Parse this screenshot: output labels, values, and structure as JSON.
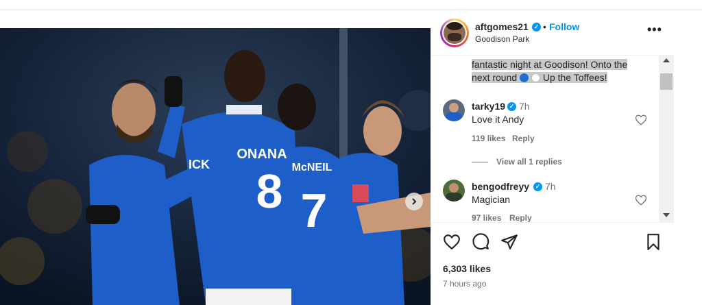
{
  "post": {
    "username": "aftgomes21",
    "separator": "•",
    "follow_label": "Follow",
    "location": "Goodison Park",
    "more_label": "•••",
    "caption_line1": "fantastic night at Goodison! Onto the",
    "caption_line2_pre": "next round",
    "caption_line2_post": "Up the Toffees!",
    "caption_emoji_colors": [
      "#1f6fd1",
      "#ffffff"
    ],
    "likes": "6,303 likes",
    "posted": "7 hours ago"
  },
  "photo": {
    "jersey_names": [
      "ONANA",
      "McNEIL"
    ],
    "jersey_numbers": [
      "8",
      "7"
    ],
    "sponsor_fragment": "ICK",
    "kit_color": "#1d5ec8"
  },
  "comments": [
    {
      "username": "tarky19",
      "time": "7h",
      "text": "Love it Andy",
      "likes": "119 likes",
      "reply_label": "Reply"
    },
    {
      "username": "bengodfreyy",
      "time": "7h",
      "text": "Magician",
      "likes": "97 likes",
      "reply_label": "Reply"
    }
  ],
  "view_replies_label": "View all 1 replies",
  "colors": {
    "accent": "#0095f6",
    "text": "#262626",
    "secondary": "#737373"
  },
  "icons": {
    "heart": "heart-icon",
    "comment": "comment-icon",
    "share": "paper-plane-icon",
    "save": "bookmark-icon",
    "next": "chevron-right-icon",
    "verified": "verified-badge-icon",
    "more": "more-options-icon"
  }
}
